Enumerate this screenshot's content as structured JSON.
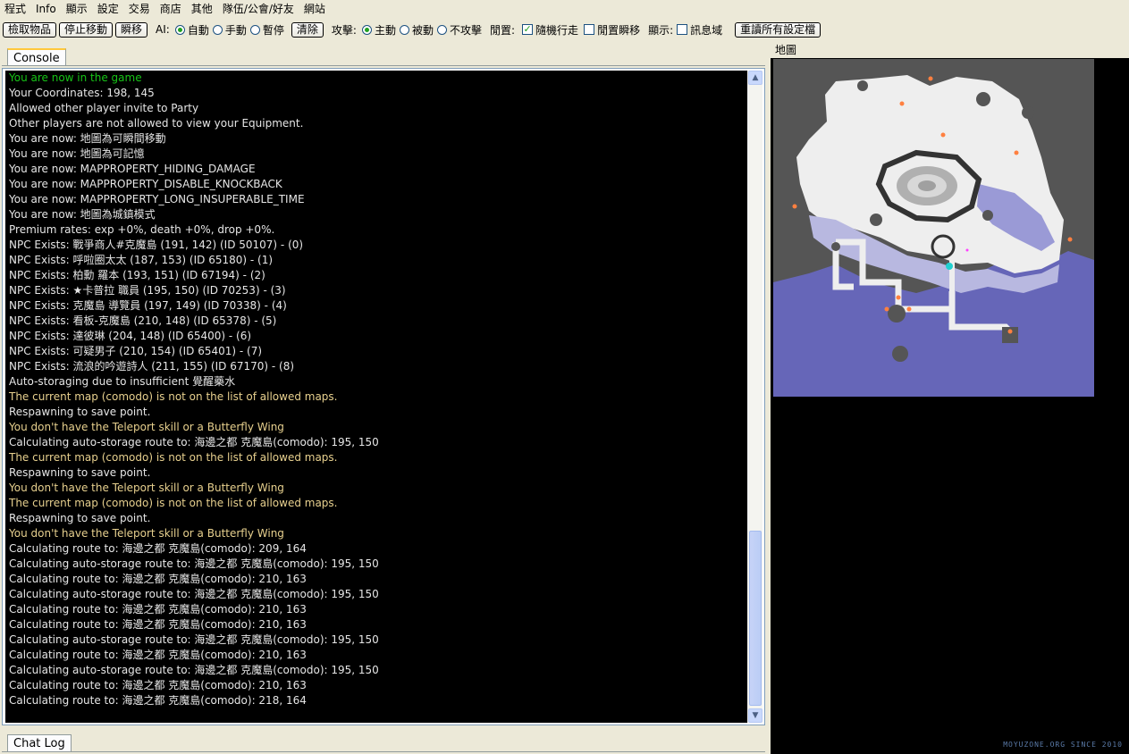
{
  "menu": [
    "程式",
    "Info",
    "顯示",
    "設定",
    "交易",
    "商店",
    "其他",
    "隊伍/公會/好友",
    "網站"
  ],
  "toolbar": {
    "pickup_button": "檢取物品",
    "stop_move_button": "停止移動",
    "teleport_button": "瞬移",
    "ai_label": "AI:",
    "ai_options": [
      "自動",
      "手動",
      "暫停"
    ],
    "ai_selected": "自動",
    "clear_button": "清除",
    "attack_label": "攻擊:",
    "attack_options": [
      "主動",
      "被動",
      "不攻擊"
    ],
    "attack_selected": "主動",
    "idle_label": "閒置:",
    "random_walk_label": "隨機行走",
    "random_walk_checked": true,
    "idle_teleport_label": "閒置瞬移",
    "idle_teleport_checked": false,
    "display_label": "顯示:",
    "message_area_label": "訊息域",
    "message_area_checked": false,
    "reload_button": "重讀所有設定檔"
  },
  "tabs": {
    "console": "Console",
    "chat_log": "Chat Log"
  },
  "map": {
    "title": "地圖",
    "watermark": "MOYUZONE.ORG SINCE 2010"
  },
  "colors": {
    "normal": "#e6e6e6",
    "success": "#17c417",
    "warning": "#e7d08e",
    "console_bg": "#000000"
  },
  "console": {
    "lines": [
      {
        "text": "You are now in the game",
        "color": "success"
      },
      {
        "text": "Your Coordinates: 198, 145",
        "color": "normal"
      },
      {
        "text": "Allowed other player invite to Party",
        "color": "normal"
      },
      {
        "text": "Other players are not allowed to view your Equipment.",
        "color": "normal"
      },
      {
        "text": "You are now: 地圖為可瞬間移動",
        "color": "normal"
      },
      {
        "text": "You are now: 地圖為可記憶",
        "color": "normal"
      },
      {
        "text": "You are now: MAPPROPERTY_HIDING_DAMAGE",
        "color": "normal"
      },
      {
        "text": "You are now: MAPPROPERTY_DISABLE_KNOCKBACK",
        "color": "normal"
      },
      {
        "text": "You are now: MAPPROPERTY_LONG_INSUPERABLE_TIME",
        "color": "normal"
      },
      {
        "text": "You are now: 地圖為城鎮模式",
        "color": "normal"
      },
      {
        "text": "Premium rates: exp +0%, death +0%, drop +0%.",
        "color": "normal"
      },
      {
        "text": "NPC Exists: 戰爭商人#克魔島 (191, 142) (ID 50107) - (0)",
        "color": "normal"
      },
      {
        "text": "NPC Exists: 呼啦圈太太 (187, 153) (ID 65180) - (1)",
        "color": "normal"
      },
      {
        "text": "NPC Exists: 柏勳 羅本 (193, 151) (ID 67194) - (2)",
        "color": "normal"
      },
      {
        "text": "NPC Exists: ★卡普拉 職員 (195, 150) (ID 70253) - (3)",
        "color": "normal"
      },
      {
        "text": "NPC Exists: 克魔島 導覽員 (197, 149) (ID 70338) - (4)",
        "color": "normal"
      },
      {
        "text": "NPC Exists: 看板-克魔島 (210, 148) (ID 65378) - (5)",
        "color": "normal"
      },
      {
        "text": "NPC Exists: 達彼琳 (204, 148) (ID 65400) - (6)",
        "color": "normal"
      },
      {
        "text": "NPC Exists: 可疑男子 (210, 154) (ID 65401) - (7)",
        "color": "normal"
      },
      {
        "text": "NPC Exists: 流浪的吟遊詩人 (211, 155) (ID 67170) - (8)",
        "color": "normal"
      },
      {
        "text": "Auto-storaging due to insufficient 覺醒藥水",
        "color": "normal"
      },
      {
        "text": "The current map (comodo) is not on the list of allowed maps.",
        "color": "warning"
      },
      {
        "text": "Respawning to save point.",
        "color": "normal"
      },
      {
        "text": "You don't have the Teleport skill or a Butterfly Wing",
        "color": "warning"
      },
      {
        "text": "Calculating auto-storage route to: 海邊之都 克魔島(comodo): 195, 150",
        "color": "normal"
      },
      {
        "text": "The current map (comodo) is not on the list of allowed maps.",
        "color": "warning"
      },
      {
        "text": "Respawning to save point.",
        "color": "normal"
      },
      {
        "text": "You don't have the Teleport skill or a Butterfly Wing",
        "color": "warning"
      },
      {
        "text": "The current map (comodo) is not on the list of allowed maps.",
        "color": "warning"
      },
      {
        "text": "Respawning to save point.",
        "color": "normal"
      },
      {
        "text": "You don't have the Teleport skill or a Butterfly Wing",
        "color": "warning"
      },
      {
        "text": "Calculating route to: 海邊之都 克魔島(comodo): 209, 164",
        "color": "normal"
      },
      {
        "text": "Calculating auto-storage route to: 海邊之都 克魔島(comodo): 195, 150",
        "color": "normal"
      },
      {
        "text": "Calculating route to: 海邊之都 克魔島(comodo): 210, 163",
        "color": "normal"
      },
      {
        "text": "Calculating auto-storage route to: 海邊之都 克魔島(comodo): 195, 150",
        "color": "normal"
      },
      {
        "text": "Calculating route to: 海邊之都 克魔島(comodo): 210, 163",
        "color": "normal"
      },
      {
        "text": "Calculating route to: 海邊之都 克魔島(comodo): 210, 163",
        "color": "normal"
      },
      {
        "text": "Calculating auto-storage route to: 海邊之都 克魔島(comodo): 195, 150",
        "color": "normal"
      },
      {
        "text": "Calculating route to: 海邊之都 克魔島(comodo): 210, 163",
        "color": "normal"
      },
      {
        "text": "Calculating auto-storage route to: 海邊之都 克魔島(comodo): 195, 150",
        "color": "normal"
      },
      {
        "text": "Calculating route to: 海邊之都 克魔島(comodo): 210, 163",
        "color": "normal"
      },
      {
        "text": "Calculating route to: 海邊之都 克魔島(comodo): 218, 164",
        "color": "normal"
      }
    ]
  }
}
